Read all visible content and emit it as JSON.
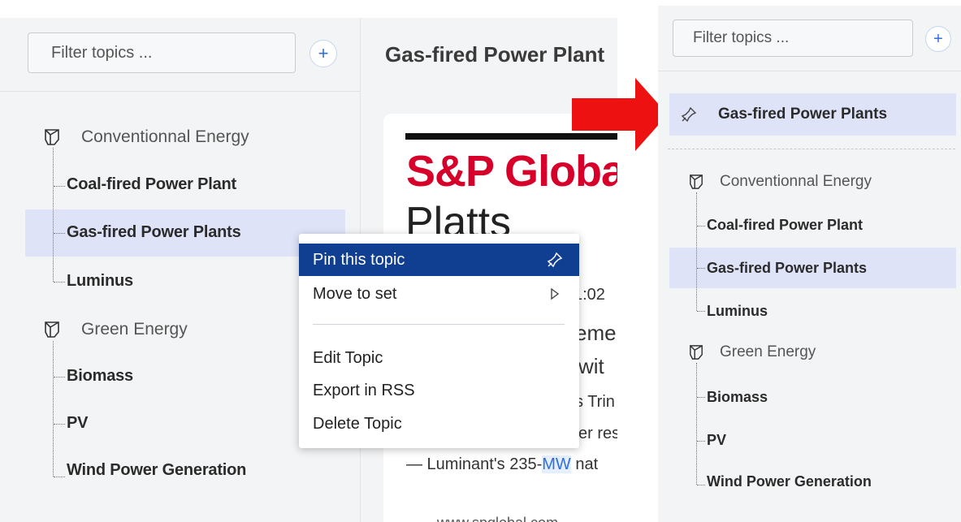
{
  "left": {
    "filter_placeholder": "Filter topics ...",
    "add_label": "+",
    "groups": [
      {
        "label": "Conventionnal Energy",
        "items": [
          "Coal-fired Power Plant",
          "Gas-fired Power Plants",
          "Luminus"
        ]
      },
      {
        "label": "Green Energy",
        "items": [
          "Biomass",
          "PV",
          "Wind Power Generation"
        ]
      }
    ]
  },
  "main": {
    "title": "Gas-fired Power Plant",
    "brand_top": "S&P Globa",
    "brand_bottom": "Platts",
    "time": "1:02",
    "headline_1": "eme",
    "headline_2": "wit",
    "body_1": "s Trin",
    "body_2": "er res",
    "body_3_pre": "— Luminant's 235-",
    "body_3_mw": "MW",
    "body_3_post": " nat",
    "footer": "www.spglobal.com"
  },
  "context_menu": {
    "items": [
      {
        "label": "Pin this topic",
        "icon": "pin-icon"
      },
      {
        "label": "Move to set",
        "icon": "chevron-right-icon"
      },
      {
        "label": "Edit Topic"
      },
      {
        "label": "Export in RSS"
      },
      {
        "label": "Delete Topic"
      }
    ]
  },
  "right": {
    "filter_placeholder": "Filter topics ...",
    "add_label": "+",
    "pinned": "Gas-fired Power Plants",
    "groups": [
      {
        "label": "Conventionnal Energy",
        "items": [
          "Coal-fired Power Plant",
          "Gas-fired Power Plants",
          "Luminus"
        ]
      },
      {
        "label": "Green Energy",
        "items": [
          "Biomass",
          "PV",
          "Wind Power Generation"
        ]
      }
    ]
  },
  "colors": {
    "accent": "#103f91",
    "selection": "#dfe3f8",
    "brand_red": "#d6002a",
    "arrow": "#ee1111"
  }
}
